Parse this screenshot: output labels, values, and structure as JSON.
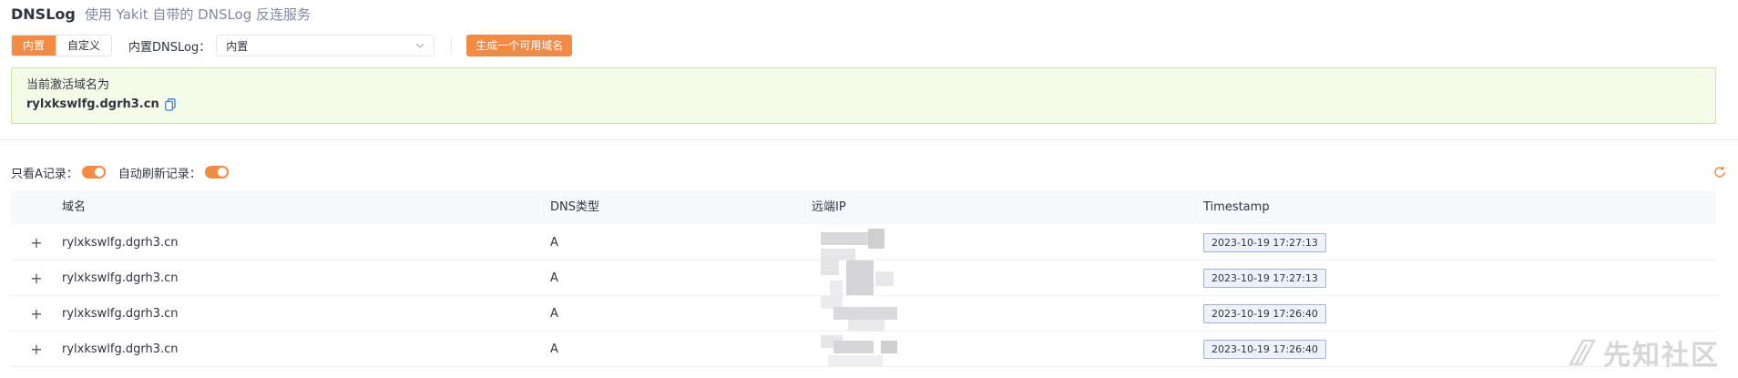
{
  "header": {
    "title": "DNSLog",
    "subtitle": "使用 Yakit 自带的 DNSLog 反连服务"
  },
  "toolbar": {
    "tabs": [
      {
        "label": "内置",
        "active": true
      },
      {
        "label": "自定义",
        "active": false
      }
    ],
    "select_label": "内置DNSLog：",
    "select_value": "内置",
    "generate_label": "生成一个可用域名"
  },
  "active_domain": {
    "label": "当前激活域名为",
    "value": "rylxkswlfg.dgrh3.cn"
  },
  "filters": {
    "only_a_label": "只看A记录：",
    "auto_refresh_label": "自动刷新记录："
  },
  "table": {
    "columns": [
      "域名",
      "DNS类型",
      "远端IP",
      "Timestamp"
    ],
    "rows": [
      {
        "expand": "+",
        "domain": "rylxkswlfg.dgrh3.cn",
        "type": "A",
        "timestamp": "2023-10-19 17:27:13"
      },
      {
        "expand": "+",
        "domain": "rylxkswlfg.dgrh3.cn",
        "type": "A",
        "timestamp": "2023-10-19 17:27:13"
      },
      {
        "expand": "+",
        "domain": "rylxkswlfg.dgrh3.cn",
        "type": "A",
        "timestamp": "2023-10-19 17:26:40"
      },
      {
        "expand": "+",
        "domain": "rylxkswlfg.dgrh3.cn",
        "type": "A",
        "timestamp": "2023-10-19 17:26:40"
      }
    ]
  },
  "watermark": {
    "text": "先知社区"
  },
  "colors": {
    "accent": "#f28b44",
    "success_bg": "#f4fbe9",
    "success_border": "#c7e8a3"
  }
}
